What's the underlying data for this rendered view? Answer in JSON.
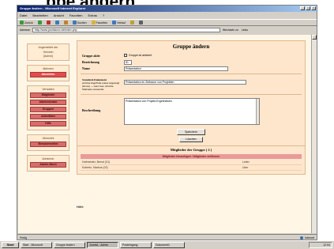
{
  "caption": "ppe ändern",
  "window": {
    "title": "Gruppe ändern - Microsoft Internet Explorer"
  },
  "menu": [
    "Datei",
    "Bearbeiten",
    "Ansicht",
    "Favoriten",
    "Extras",
    "?"
  ],
  "toolbar": {
    "items": [
      {
        "label": "Zurück",
        "icon": "back-icon",
        "color": "#3a9a3a"
      },
      {
        "label": "",
        "icon": "forward-icon",
        "color": "#3a9a3a"
      },
      {
        "label": "",
        "icon": "stop-icon",
        "color": "#c03030"
      },
      {
        "label": "",
        "icon": "refresh-icon",
        "color": "#3a7ac0"
      },
      {
        "label": "",
        "icon": "home-icon",
        "color": "#c08030"
      },
      {
        "label": "Suchen",
        "icon": "search-icon",
        "color": "#3a7ac0"
      },
      {
        "label": "Favoriten",
        "icon": "favorites-icon",
        "color": "#e0b030"
      },
      {
        "label": "Verlauf",
        "icon": "history-icon",
        "color": "#3a7ac0"
      },
      {
        "label": "",
        "icon": "mail-icon",
        "color": "#c0a030"
      },
      {
        "label": "",
        "icon": "print-icon",
        "color": "#606060"
      }
    ]
  },
  "address": {
    "label": "Adresse",
    "url": "http://www.joomlaxxx.de/index.php",
    "go": "Wechseln zu",
    "links": "Links"
  },
  "sidebar": {
    "section1": {
      "head": "Angemeldet als:",
      "lines": [
        "Heinrich",
        "[Admin]"
      ]
    },
    "section2": {
      "head": "Aktionen",
      "buttons": [
        {
          "label": "Abmelden",
          "selected": true
        }
      ]
    },
    "section3": {
      "head": "Verwalten",
      "buttons": [
        {
          "label": "Mitglieder",
          "selected": false
        },
        {
          "label": "Administrator",
          "selected": false
        },
        {
          "label": "Gruppen",
          "selected": false
        },
        {
          "label": "Aktivitäten",
          "selected": false
        },
        {
          "label": "Hilfe",
          "selected": false
        }
      ]
    },
    "section4": {
      "head": "Übersicht",
      "buttons": [
        {
          "label": "Benutzerseiten",
          "selected": false
        }
      ]
    },
    "section5": {
      "head": "Administr.",
      "buttons": [
        {
          "label": "Admin-Menü",
          "selected": false
        }
      ]
    }
  },
  "form": {
    "title": "Gruppe ändern",
    "status_label": "Gruppe aktiv",
    "status_checkbox_text": "Gruppe ist aktiviert",
    "short_label": "Bezeichnung",
    "short_value": "ID",
    "name_label": "Name",
    "name_value": "Präsentation",
    "notify_label": "Standard-Dokument",
    "notify_hint": "wird bei Zugriff als erstes angezeigt (Home) — wenn leer, wird die Startseite verwendet",
    "notify_value": "Präsentation im Zeitraum von Projekten",
    "desc_label": "Beschreibung",
    "desc_value": "Präsentation von Projekt-Ergebnissen",
    "save_button": "Speichern",
    "delete_button": "Löschen"
  },
  "members": {
    "title": "Mitglieder der Gruppe ( 2 )",
    "bar": "Mitglieder hinzufügen / Mitglieder entfernen",
    "rows": [
      {
        "name": "Hofmeister, Bernd (01)",
        "role": "Leiter"
      },
      {
        "name": "Kobertz, Markus (02)",
        "role": "User"
      }
    ]
  },
  "footer": "Hilfe",
  "statusbar": {
    "left": "Fertig",
    "zone": "Internet"
  },
  "taskbar": {
    "start": "Start",
    "tasks": [
      {
        "label": "Start - Microsoft",
        "active": false
      },
      {
        "label": "Gruppe ändern",
        "active": false
      },
      {
        "label": "Joomla - Admin",
        "active": true
      },
      {
        "label": "Posteingang",
        "active": false
      },
      {
        "label": "Dokument1",
        "active": false
      }
    ],
    "clock": "12:04"
  }
}
